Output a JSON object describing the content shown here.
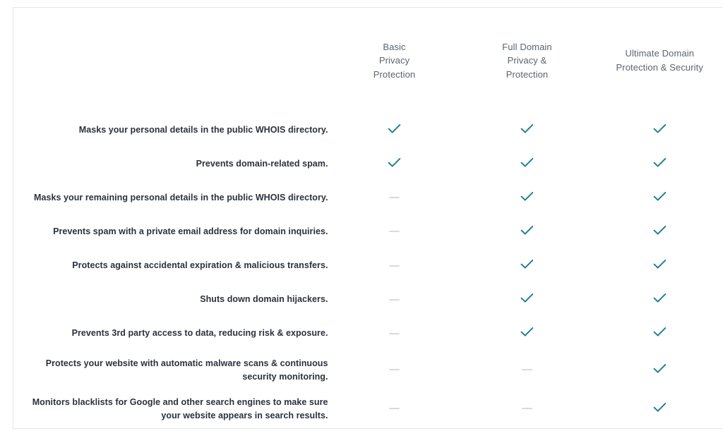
{
  "table": {
    "name": "domain-privacy-plan-comparison",
    "feature_column_header": "",
    "plans": [
      {
        "id": "basic-privacy-protection",
        "label": "Basic\nPrivacy\nProtection"
      },
      {
        "id": "full-domain-privacy-protection",
        "label": "Full Domain\nPrivacy &\nProtection"
      },
      {
        "id": "ultimate-domain-protection-security",
        "label": "Ultimate Domain\nProtection & Security"
      }
    ],
    "rows": [
      {
        "feature": "Masks your personal details in the public WHOIS directory.",
        "values": [
          "check",
          "check",
          "check"
        ]
      },
      {
        "feature": "Prevents domain-related spam.",
        "values": [
          "check",
          "check",
          "check"
        ]
      },
      {
        "feature": "Masks your remaining personal details in the public WHOIS directory.",
        "values": [
          "dash",
          "check",
          "check"
        ]
      },
      {
        "feature": "Prevents spam with a private email address for domain inquiries.",
        "values": [
          "dash",
          "check",
          "check"
        ]
      },
      {
        "feature": "Protects against accidental expiration & malicious transfers.",
        "values": [
          "dash",
          "check",
          "check"
        ]
      },
      {
        "feature": "Shuts down domain hijackers.",
        "values": [
          "dash",
          "check",
          "check"
        ]
      },
      {
        "feature": "Prevents 3rd party access to data, reducing risk & exposure.",
        "values": [
          "dash",
          "check",
          "check"
        ]
      },
      {
        "feature": "Protects your website with automatic malware scans & continuous security monitoring.",
        "values": [
          "dash",
          "dash",
          "check"
        ]
      },
      {
        "feature": "Monitors blacklists for Google and other search engines to make sure your website appears in search results.",
        "values": [
          "dash",
          "dash",
          "check"
        ]
      }
    ],
    "icons": {
      "check": "check-icon",
      "dash": "dash-icon"
    }
  },
  "colors": {
    "check": "#1a7f8d",
    "dash": "#d8dadd",
    "border": "#e4e6e8",
    "divider": "#eceef0",
    "feature_text": "#2b323d",
    "plan_header_text": "#5b6470",
    "background": "#ffffff"
  }
}
